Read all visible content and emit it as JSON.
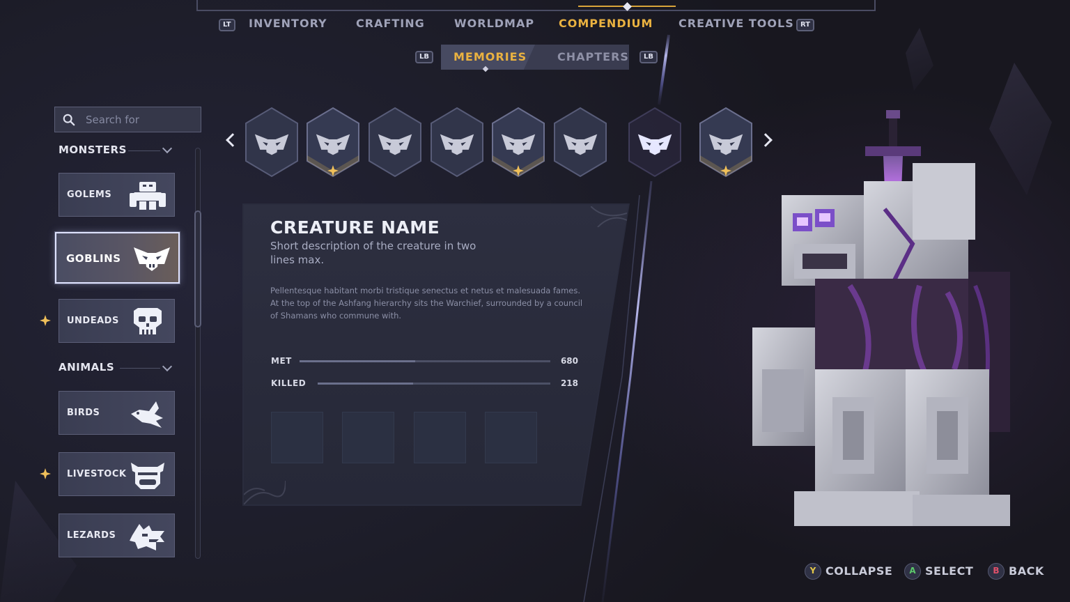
{
  "nav": {
    "left_bumper": "LT",
    "right_bumper": "RT",
    "tabs": [
      {
        "label": "INVENTORY",
        "active": false
      },
      {
        "label": "CRAFTING",
        "active": false
      },
      {
        "label": "WORLDMAP",
        "active": false
      },
      {
        "label": "COMPENDIUM",
        "active": true
      },
      {
        "label": "CREATIVE TOOLS",
        "active": false
      }
    ]
  },
  "subnav": {
    "left_bumper": "LB",
    "right_bumper": "LB",
    "tabs": [
      {
        "label": "MEMORIES",
        "active": true
      },
      {
        "label": "CHAPTERS",
        "active": false
      }
    ]
  },
  "search": {
    "placeholder": "Search for",
    "value": ""
  },
  "sidebar": {
    "sections": [
      {
        "title": "MONSTERS",
        "items": [
          {
            "label": "GOLEMS",
            "icon": "golem-icon",
            "starred": false,
            "active": false
          },
          {
            "label": "GOBLINS",
            "icon": "goblin-icon",
            "starred": false,
            "active": true
          },
          {
            "label": "UNDEADS",
            "icon": "skull-icon",
            "starred": true,
            "active": false
          }
        ]
      },
      {
        "title": "ANIMALS",
        "items": [
          {
            "label": "BIRDS",
            "icon": "bird-icon",
            "starred": false,
            "active": false
          },
          {
            "label": "LIVESTOCK",
            "icon": "livestock-icon",
            "starred": true,
            "active": false
          },
          {
            "label": "LEZARDS",
            "icon": "lizard-icon",
            "starred": false,
            "active": false
          }
        ]
      }
    ]
  },
  "carousel": {
    "items": [
      {
        "icon": "goblin-icon",
        "starred": false,
        "selected": false
      },
      {
        "icon": "goblin-icon",
        "starred": true,
        "selected": false
      },
      {
        "icon": "goblin-icon",
        "starred": false,
        "selected": false
      },
      {
        "icon": "goblin-icon",
        "starred": false,
        "selected": false
      },
      {
        "icon": "goblin-icon",
        "starred": true,
        "selected": false
      },
      {
        "icon": "goblin-icon",
        "starred": false,
        "selected": false
      },
      {
        "icon": "goblin-icon",
        "starred": false,
        "selected": true
      },
      {
        "icon": "goblin-icon",
        "starred": true,
        "selected": false
      }
    ]
  },
  "detail": {
    "title": "CREATURE NAME",
    "subtitle": "Short description of the creature in two lines max.",
    "body": "Pellentesque habitant morbi tristique senectus et netus et malesuada fames. At the top of the Ashfang hierarchy sits the Warchief, surrounded by a council of Shamans who commune with.",
    "stats": [
      {
        "label": "MET",
        "value": "680"
      },
      {
        "label": "KILLED",
        "value": "218"
      }
    ],
    "slots": 4
  },
  "hints": [
    {
      "button": "Y",
      "label": "COLLAPSE",
      "color": "#e2c64a"
    },
    {
      "button": "A",
      "label": "SELECT",
      "color": "#5cc86b"
    },
    {
      "button": "B",
      "label": "BACK",
      "color": "#e0506a"
    }
  ],
  "colors": {
    "accent_gold": "#eab240",
    "selected_border": "#dfe3ff",
    "panel_bg": "#2a2c3d",
    "glow_purple": "#b85cff"
  }
}
